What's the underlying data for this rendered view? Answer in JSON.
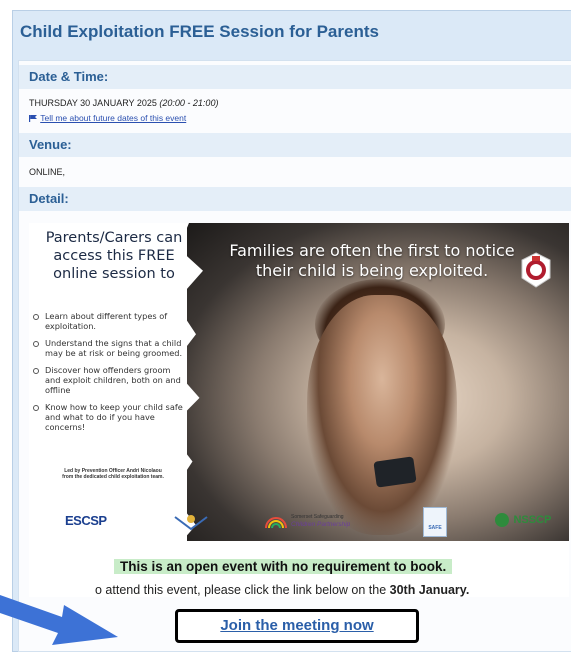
{
  "page": {
    "title": "Child Exploitation FREE Session for Parents"
  },
  "date_time": {
    "heading": "Date & Time:",
    "day": "THURSDAY 30 JANUARY 2025",
    "time": "(20:00 - 21:00)",
    "future_link": "Tell me about future dates of this event"
  },
  "venue": {
    "heading": "Venue:",
    "value": "ONLINE,"
  },
  "detail": {
    "heading": "Detail:"
  },
  "flyer": {
    "left_title": "Parents/Carers can access this FREE online session to",
    "bullets": [
      "Learn about different types of exploitation.",
      "Understand the signs that a child may be at risk or being groomed.",
      "Discover how offenders groom and exploit children, both on and offline",
      "Know how to keep your child safe and what to do if you have concerns!"
    ],
    "led_by": "Led by Prevention Officer Andri Nicolaou from the dedicated child exploitation team.",
    "headline": "Families are often the first to notice their child is being exploited.",
    "logos": {
      "escsp": "ESCSP",
      "somerset_line1": "Somerset Safeguarding",
      "somerset_line2": "Children Partnership",
      "keeping_safe": "SAFE",
      "nsscp": "NSSCP"
    }
  },
  "open_event": "This is an open event with no requirement to book.",
  "attend": {
    "prefix": "o attend this event, please click the link below on the ",
    "date": "30th January."
  },
  "join_link": "Join the meeting now",
  "colors": {
    "title_blue": "#2b5f95",
    "highlight_green": "#c8ecc8",
    "arrow_blue": "#3d72d6"
  }
}
